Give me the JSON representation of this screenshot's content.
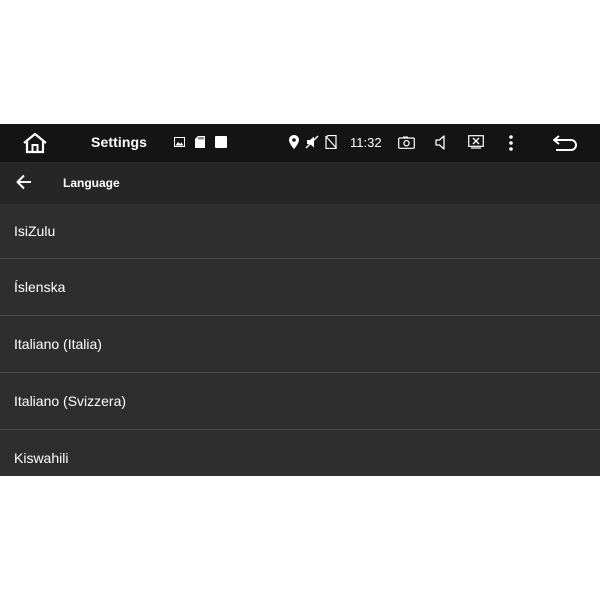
{
  "statusbar": {
    "title": "Settings",
    "time": "11:32",
    "icons": [
      "home-icon",
      "image-icon",
      "sd-card-icon",
      "stop-square-icon",
      "location-icon",
      "mute-icon",
      "no-sim-icon",
      "screenshot-icon",
      "volume-icon",
      "close-window-icon",
      "more-vert-icon",
      "back-icon"
    ]
  },
  "toolbar": {
    "title": "Language"
  },
  "languages": [
    {
      "label": "IsiZulu"
    },
    {
      "label": "Íslenska"
    },
    {
      "label": "Italiano (Italia)"
    },
    {
      "label": "Italiano (Svizzera)"
    },
    {
      "label": "Kiswahili"
    }
  ],
  "colors": {
    "statusbar_bg": "#141414",
    "toolbar_bg": "#262626",
    "list_bg": "#2e2e2e",
    "divider": "#4a4a4a",
    "text": "#ffffff"
  }
}
